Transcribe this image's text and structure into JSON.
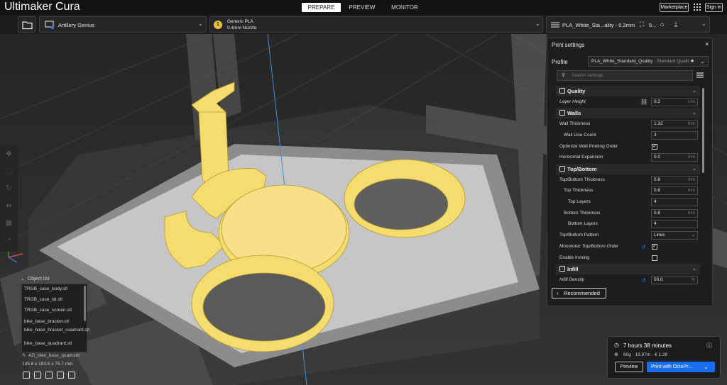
{
  "app": {
    "title": "Ultimaker Cura"
  },
  "stages": [
    {
      "label": "PREPARE",
      "active": true
    },
    {
      "label": "PREVIEW",
      "active": false
    },
    {
      "label": "MONITOR",
      "active": false
    }
  ],
  "header_right": {
    "marketplace": "Marketplace",
    "signin": "Sign in"
  },
  "toolbar": {
    "printer": "Artillery Genius",
    "material": "Generic PLA",
    "nozzle": "0.4mm Nozzle",
    "material_badge": "1",
    "profile_summary": "PLA_White_Sta...ality - 0.2mm",
    "infill_short": "5..."
  },
  "settings": {
    "title": "Print settings",
    "profile_label": "Profile",
    "profile_name": "PLA_White_Standard_Quality",
    "profile_suffix": " - Standard Qualit...",
    "search_placeholder": "Search settings",
    "recommended": "Recommended",
    "rows": [
      {
        "kind": "cat",
        "label": "Quality"
      },
      {
        "kind": "set",
        "label": "Layer Height",
        "italic": true,
        "indent": 0,
        "value": "0.2",
        "unit": "mm",
        "icon": "link"
      },
      {
        "kind": "cat",
        "label": "Walls"
      },
      {
        "kind": "set",
        "label": "Wall Thickness",
        "indent": 0,
        "value": "1.32",
        "unit": "mm"
      },
      {
        "kind": "set",
        "label": "Wall Line Count",
        "indent": 1,
        "value": "3",
        "unit": ""
      },
      {
        "kind": "check",
        "label": "Optimize Wall Printing Order",
        "indent": 0,
        "checked": true
      },
      {
        "kind": "set",
        "label": "Horizontal Expansion",
        "indent": 0,
        "value": "0.0",
        "unit": "mm"
      },
      {
        "kind": "cat",
        "label": "Top/Bottom"
      },
      {
        "kind": "set",
        "label": "Top/Bottom Thickness",
        "indent": 0,
        "value": "0.8",
        "unit": "mm"
      },
      {
        "kind": "set",
        "label": "Top Thickness",
        "indent": 1,
        "value": "0.8",
        "unit": "mm"
      },
      {
        "kind": "set",
        "label": "Top Layers",
        "indent": 2,
        "value": "4",
        "unit": ""
      },
      {
        "kind": "set",
        "label": "Bottom Thickness",
        "indent": 1,
        "value": "0.8",
        "unit": "mm"
      },
      {
        "kind": "set",
        "label": "Bottom Layers",
        "indent": 2,
        "value": "4",
        "unit": ""
      },
      {
        "kind": "select",
        "label": "Top/Bottom Pattern",
        "indent": 0,
        "value": "Lines"
      },
      {
        "kind": "check",
        "label": "Monotonic Top/Bottom Order",
        "italic": true,
        "indent": 0,
        "checked": true,
        "icon": "reset"
      },
      {
        "kind": "check",
        "label": "Enable Ironing",
        "indent": 0,
        "checked": false
      },
      {
        "kind": "cat",
        "label": "Infill"
      },
      {
        "kind": "set",
        "label": "Infill Density",
        "italic": true,
        "indent": 0,
        "value": "50.0",
        "unit": "%",
        "icon": "reset"
      }
    ]
  },
  "object_list": {
    "header": "Object list",
    "items": [
      "TRGB_case_body.stl",
      "TRGB_case_lid.stl",
      "TRGB_case_screen.stl",
      "bike_base_bracket.stl",
      "bike_base_bracket_cuadrant.stl",
      "bike_base_quadrant.stl"
    ],
    "current": "AG_bike_base_quadrant",
    "dimensions": "145.6 x 193.5 x 75.7 mm"
  },
  "estimate": {
    "time": "7 hours 38 minutes",
    "material": "60g · 19.97m · € 1.28",
    "preview_button": "Preview",
    "print_button": "Print with OctoPr..."
  },
  "colors": {
    "accent": "#196ef0",
    "model": "#f5dc6e",
    "plate": "#c8c8c8"
  }
}
